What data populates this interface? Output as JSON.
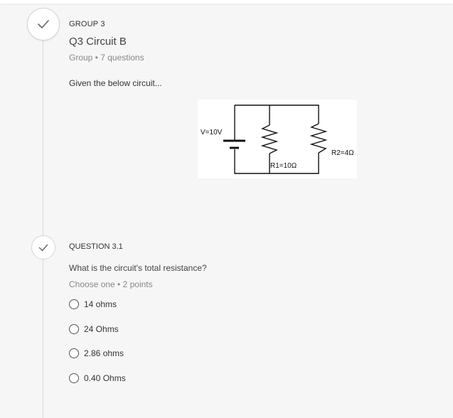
{
  "group": {
    "label": "GROUP 3",
    "title": "Q3 Circuit B",
    "meta": "Group • 7 questions",
    "intro": "Given the below circuit..."
  },
  "circuit": {
    "voltage_label": "V=10V",
    "r1_label": "R1=10Ω",
    "r2_label": "R2=4Ω"
  },
  "question": {
    "label": "QUESTION 3.1",
    "text": "What is the circuit's total resistance?",
    "meta": "Choose one • 2 points",
    "options": [
      {
        "label": "14 ohms",
        "selected": false
      },
      {
        "label": "24 Ohms",
        "selected": false
      },
      {
        "label": "2.86 ohms",
        "selected": false
      },
      {
        "label": "0.40 Ohms",
        "selected": false
      }
    ]
  },
  "icons": {
    "group_status": "checkmark-icon",
    "question_status": "checkmark-icon"
  }
}
